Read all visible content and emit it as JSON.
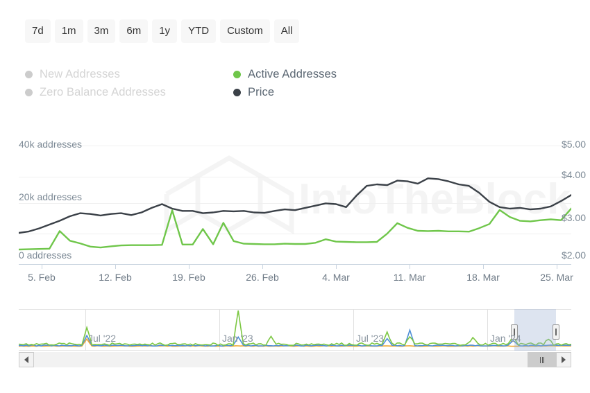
{
  "range_buttons": [
    {
      "label": "7d",
      "style": "chip"
    },
    {
      "label": "1m",
      "style": "chip"
    },
    {
      "label": "3m",
      "style": "chip"
    },
    {
      "label": "6m",
      "style": "chip"
    },
    {
      "label": "1y",
      "style": "chip"
    },
    {
      "label": "YTD",
      "style": "chip"
    },
    {
      "label": "Custom",
      "style": "chip"
    },
    {
      "label": "All",
      "style": "chip"
    }
  ],
  "legend": [
    {
      "label": "New Addresses",
      "color": "#cccccc",
      "enabled": false
    },
    {
      "label": "Active Addresses",
      "color": "#6fc64a",
      "enabled": true
    },
    {
      "label": "Zero Balance Addresses",
      "color": "#cccccc",
      "enabled": false
    },
    {
      "label": "Price",
      "color": "#3b4148",
      "enabled": true
    }
  ],
  "watermark": "IntoTheBlock",
  "navigator": {
    "labels": [
      "Jul '22",
      "Jan '23",
      "Jul '23",
      "Jan '24"
    ],
    "selection_label": "selected-range",
    "scrollbar": {
      "left_arrow": "scroll-left",
      "right_arrow": "scroll-right",
      "thumb": "scroll-thumb"
    }
  },
  "chart_data": {
    "type": "line",
    "title": "",
    "xlabel": "",
    "grid": true,
    "legend_position": "top",
    "x_ticks": [
      "5. Feb",
      "12. Feb",
      "19. Feb",
      "26. Feb",
      "4. Mar",
      "11. Mar",
      "18. Mar",
      "25. Mar"
    ],
    "left_axis": {
      "label": "addresses",
      "ticks": [
        "0 addresses",
        "20k addresses",
        "40k addresses"
      ],
      "tick_values": [
        0,
        20000,
        40000
      ],
      "ylim": [
        0,
        44000
      ]
    },
    "right_axis": {
      "label": "price",
      "ticks": [
        "$2.00",
        "$3.00",
        "$4.00",
        "$5.00"
      ],
      "tick_values": [
        2.0,
        3.0,
        4.0,
        5.0
      ],
      "ylim": [
        1.8,
        5.2
      ]
    },
    "series": [
      {
        "name": "Active Addresses",
        "color": "#6fc64a",
        "axis": "left",
        "unit": "addresses",
        "values": [
          5200,
          5300,
          5400,
          5500,
          11500,
          8200,
          7300,
          6200,
          5900,
          6300,
          6600,
          6700,
          6700,
          6700,
          6800,
          18600,
          6900,
          6900,
          12200,
          7000,
          14300,
          8100,
          7200,
          7100,
          7000,
          7000,
          7200,
          7100,
          7100,
          7500,
          8700,
          7900,
          7800,
          7700,
          7700,
          7800,
          10600,
          14200,
          12600,
          11600,
          11500,
          11600,
          11400,
          11400,
          11300,
          12500,
          13900,
          18700,
          16300,
          15000,
          14800,
          15200,
          15500,
          15200,
          19200
        ]
      },
      {
        "name": "Price",
        "color": "#3b4148",
        "axis": "right",
        "unit": "USD",
        "values": [
          2.64,
          2.68,
          2.76,
          2.86,
          2.96,
          3.08,
          3.16,
          3.14,
          3.1,
          3.14,
          3.16,
          3.11,
          3.18,
          3.3,
          3.4,
          3.28,
          3.22,
          3.22,
          3.16,
          3.18,
          3.22,
          3.21,
          3.22,
          3.18,
          3.17,
          3.22,
          3.26,
          3.24,
          3.3,
          3.36,
          3.42,
          3.4,
          3.32,
          3.62,
          3.88,
          3.92,
          3.9,
          4.02,
          4.0,
          3.94,
          4.08,
          4.06,
          4.0,
          3.92,
          3.88,
          3.7,
          3.46,
          3.32,
          3.28,
          3.3,
          3.26,
          3.28,
          3.34,
          3.48,
          3.64
        ]
      }
    ],
    "navigator_series": [
      {
        "name": "Active Addresses",
        "color": "#7cc743"
      },
      {
        "name": "New Addresses",
        "color": "#4f8fd6"
      },
      {
        "name": "Zero Balance Addresses",
        "color": "#f0a830"
      }
    ]
  }
}
